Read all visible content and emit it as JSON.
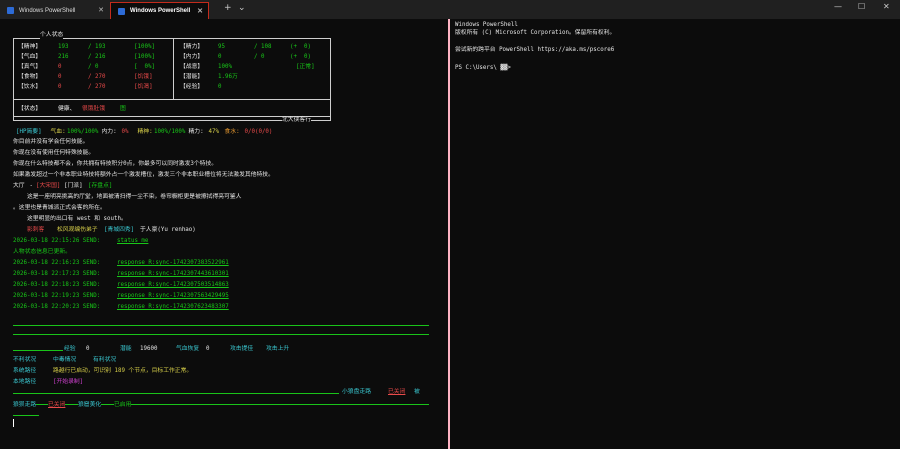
{
  "tabs": [
    {
      "title": "Windows PowerShell"
    },
    {
      "title": "Windows PowerShell"
    }
  ],
  "titlebar": {
    "new_tab": "+",
    "dropdown": "⌄",
    "minimize": "—",
    "maximize": "☐",
    "close": "✕"
  },
  "left": {
    "status_title": "个人状态",
    "stats_left": [
      {
        "label": "【精神】",
        "cur": "193",
        "max": "/ 193",
        "pct": "[100%]"
      },
      {
        "label": "【气血】",
        "cur": "216",
        "max": "/ 216",
        "pct": "[100%]"
      },
      {
        "label": "【真气】",
        "cur": "0",
        "max": "/ 0",
        "pct": "[  0%]"
      },
      {
        "label": "【食物】",
        "cur": "0",
        "max": "/ 270",
        "pct": "[饥饿]"
      },
      {
        "label": "【饮水】",
        "cur": "0",
        "max": "/ 270",
        "pct": "[饥渴]"
      }
    ],
    "stats_right": [
      {
        "label": "【精力】",
        "v1": "95",
        "v2": "/ 108",
        "v3": "(+  0)"
      },
      {
        "label": "【内力】",
        "v1": "0",
        "v2": "/ 0",
        "v3": "(+  0)"
      },
      {
        "label": "【战意】",
        "v1": "100%",
        "v2": "",
        "v3": "[正常]"
      },
      {
        "label": "【潜能】",
        "v1": "1.96万",
        "v2": "",
        "v3": ""
      },
      {
        "label": "【经验】",
        "v1": "0",
        "v2": "",
        "v3": ""
      }
    ],
    "state_label": "【状态】",
    "state_ok": "健康、",
    "state_bad": "很饿肚饿",
    "state_end": "图",
    "footer_title": "北大侠客行",
    "hp_line": {
      "tag": "[HP简要]",
      "qx_label": " 气血:",
      "qx_val": "100%/100%",
      "nl_label": " 内力:",
      "nl_val": " 0%",
      "js_label": " 精神:",
      "js_val": "100%/100%",
      "jl_label": " 精力:",
      "jl_val": " 47%",
      "sw_label": " 食水:",
      "sw_val": " 0/0(0/0)"
    },
    "lines1": [
      "你目前并没有学会任何技能。",
      "你现在没有使用任何特殊技能。",
      "你现在什么特技都不会，你共拥有特技积分0点，你最多可以同时激发3个特技。",
      "如果激发超过一个非本职业特技将额外占一个激发槽位，激发三个非本职业槽位将无法激发其他特技。"
    ],
    "room": {
      "name": "大厅",
      "sep": " - ",
      "tag1": "[大宋国]",
      "tag2": "[门派]",
      "tag3": "[存盘点]"
    },
    "room_desc": [
      "    这是一座明亮挑高的厅堂，地面被清扫得一尘不染，卷帘橱柜更是被擦拭得亮可鉴人",
      "。这里也是青城派正式会客的所在。",
      "    这里明显的出口有 west 和 south。"
    ],
    "npc": {
      "prefix": "    影刺客 ",
      "name": "松风观编伤弟子",
      "title": "[青城四秀]",
      "rest": "于人豪(Yu renhao)"
    },
    "log": [
      {
        "time": "2026-03-18 22:15:26 SEND:",
        "msg": "status_me"
      },
      {
        "time": "人物状态信息已更新。",
        "msg": ""
      },
      {
        "time": "2026-03-18 22:16:23 SEND:",
        "msg": "response R:sync-1742307383522961"
      },
      {
        "time": "2026-03-18 22:17:23 SEND:",
        "msg": "response R:sync-1742307443610301"
      },
      {
        "time": "2026-03-18 22:18:23 SEND:",
        "msg": "response R:sync-1742307503514863"
      },
      {
        "time": "2026-03-18 22:19:23 SEND:",
        "msg": "response R:sync-1742307563429495"
      },
      {
        "time": "2026-03-18 22:20:23 SEND:",
        "msg": "response R:sync-1742307623483307"
      }
    ],
    "bottom": {
      "exp_label": "经验",
      "exp_val": "0",
      "pot_label": "潜能",
      "pot_val": "19600",
      "qx_label": "气血恢复",
      "qx_val": "0",
      "gain1": "攻击提佳",
      "gain2": "攻击上升",
      "row2": [
        "不利状况",
        "中毒情况",
        "有利状况"
      ],
      "sys_label": "系统路径",
      "sys_msg": "路越行已启动，可识别 189 个节点，目标工作正常。",
      "path_label": "本地路径",
      "path_val": "[开始录制]",
      "auto_label": "小狼盘走路",
      "auto_state": "已关闭",
      "auto_end": "被",
      "walk_label": "狼狈走路",
      "walk_state": "已关闭",
      "beauty_label": "狼窟美化",
      "beauty_state": "已启用"
    }
  },
  "right": {
    "lines": [
      "Windows PowerShell",
      "版权所有 (C) Microsoft Corporation。保留所有权利。",
      "",
      "尝试新的跨平台 PowerShell https://aka.ms/pscore6",
      ""
    ],
    "prompt": "PS C:\\Users\\ ▓▓>"
  },
  "colors": {
    "green": "#18c818",
    "cyan": "#3ac7d0",
    "red": "#e84a4a",
    "yellow": "#d8d04a",
    "tab_border": "#c42b1c"
  }
}
